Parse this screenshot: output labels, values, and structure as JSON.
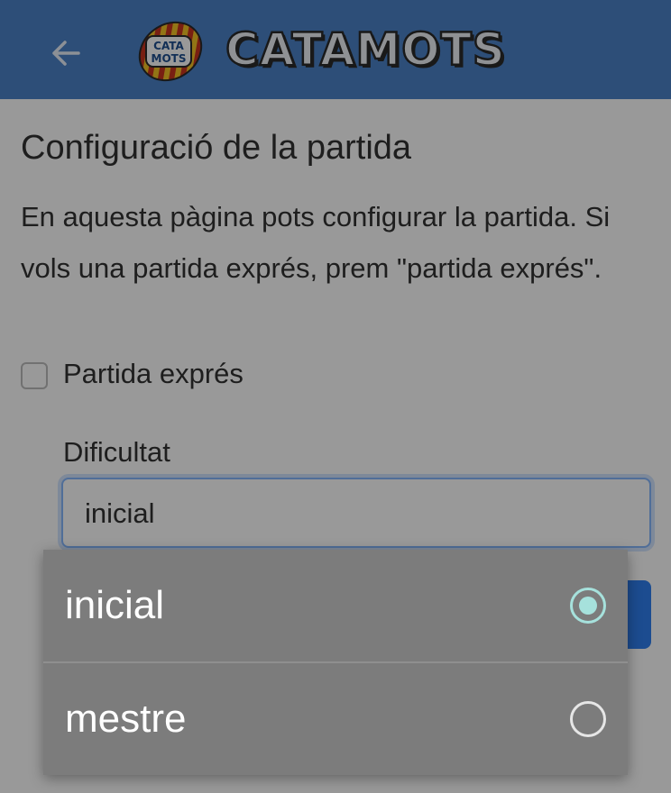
{
  "header": {
    "logo_text_line1": "CATA",
    "logo_text_line2": "MOTS",
    "brand": "CATAMOTS",
    "bar_color": "#4b82c8"
  },
  "page": {
    "title": "Configuració de la partida",
    "intro": "En aquesta pàgina pots configurar la partida. Si vols una partida exprés, prem \"partida exprés\".",
    "express_checkbox": {
      "label": "Partida exprés",
      "checked": false
    },
    "difficulty": {
      "label": "Dificultat",
      "value": "inicial"
    }
  },
  "dialog": {
    "options": [
      {
        "label": "inicial",
        "selected": true
      },
      {
        "label": "mestre",
        "selected": false
      }
    ],
    "radio_checked_color": "#a6e1dc"
  },
  "icons": {
    "back": "arrow-left-icon",
    "radio_on": "radio-checked-icon",
    "radio_off": "radio-unchecked-icon"
  }
}
